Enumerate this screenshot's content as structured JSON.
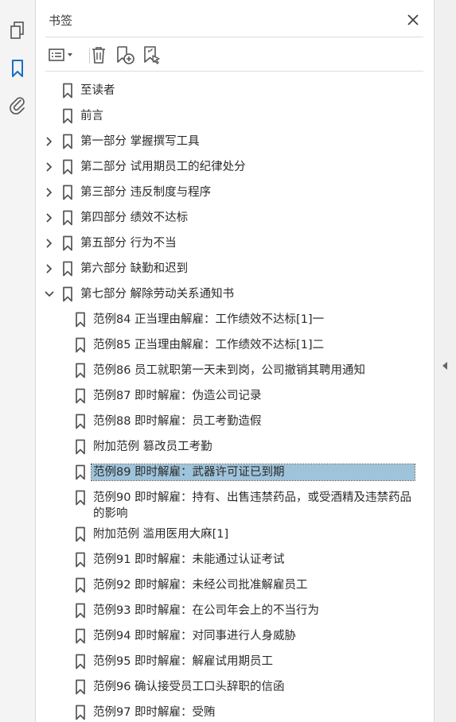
{
  "sidebar": {
    "title": "书签",
    "rail_icons": [
      "pages-icon",
      "bookmark-icon",
      "attachment-icon"
    ]
  },
  "colors": {
    "selection": "#9ec3da",
    "icon": "#555555",
    "active_icon": "#1a6fc4"
  },
  "bookmarks": [
    {
      "label": "至读者",
      "level": 0,
      "expandable": false
    },
    {
      "label": "前言",
      "level": 0,
      "expandable": false
    },
    {
      "label": "第一部分 掌握撰写工具",
      "level": 0,
      "expandable": true,
      "expanded": false
    },
    {
      "label": "第二部分 试用期员工的纪律处分",
      "level": 0,
      "expandable": true,
      "expanded": false
    },
    {
      "label": "第三部分 违反制度与程序",
      "level": 0,
      "expandable": true,
      "expanded": false
    },
    {
      "label": "第四部分 绩效不达标",
      "level": 0,
      "expandable": true,
      "expanded": false
    },
    {
      "label": "第五部分 行为不当",
      "level": 0,
      "expandable": true,
      "expanded": false
    },
    {
      "label": "第六部分 缺勤和迟到",
      "level": 0,
      "expandable": true,
      "expanded": false
    },
    {
      "label": "第七部分 解除劳动关系通知书",
      "level": 0,
      "expandable": true,
      "expanded": true
    },
    {
      "label": "范例84 正当理由解雇：工作绩效不达标[1]一",
      "level": 1
    },
    {
      "label": "范例85 正当理由解雇：工作绩效不达标[1]二",
      "level": 1
    },
    {
      "label": "范例86 员工就职第一天未到岗，公司撤销其聘用通知",
      "level": 1
    },
    {
      "label": "范例87 即时解雇：伪造公司记录",
      "level": 1
    },
    {
      "label": "范例88 即时解雇：员工考勤造假",
      "level": 1
    },
    {
      "label": "附加范例 篡改员工考勤",
      "level": 1
    },
    {
      "label": "范例89 即时解雇：武器许可证已到期",
      "level": 1,
      "selected": true
    },
    {
      "label": "范例90 即时解雇：持有、出售违禁药品，或受酒精及违禁药品的影响",
      "level": 1,
      "wrap": true
    },
    {
      "label": "附加范例 滥用医用大麻[1]",
      "level": 1
    },
    {
      "label": "范例91 即时解雇：未能通过认证考试",
      "level": 1
    },
    {
      "label": "范例92 即时解雇：未经公司批准解雇员工",
      "level": 1
    },
    {
      "label": "范例93 即时解雇：在公司年会上的不当行为",
      "level": 1
    },
    {
      "label": "范例94 即时解雇：对同事进行人身威胁",
      "level": 1
    },
    {
      "label": "范例95 即时解雇：解雇试用期员工",
      "level": 1
    },
    {
      "label": "范例96 确认接受员工口头辞职的信函",
      "level": 1
    },
    {
      "label": "范例97 即时解雇：受贿",
      "level": 1
    }
  ]
}
